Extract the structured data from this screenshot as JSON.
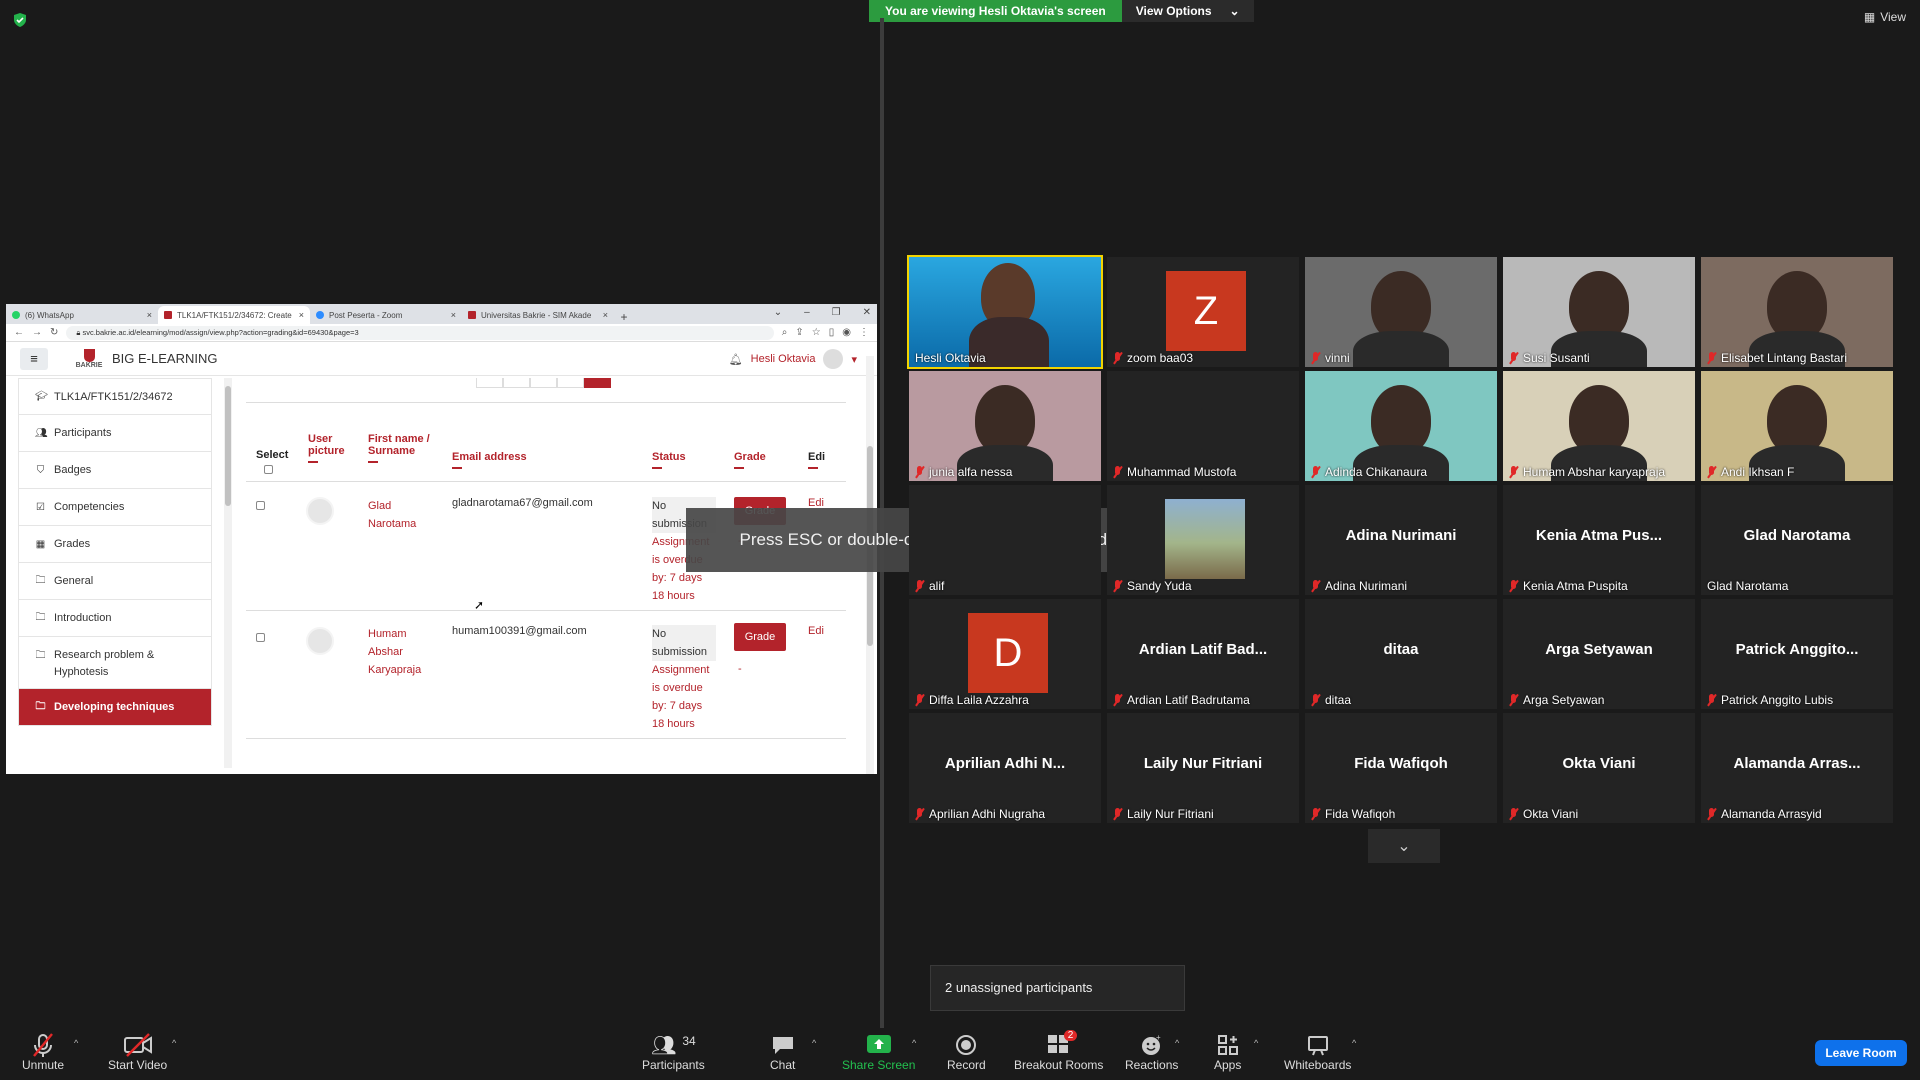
{
  "zoom": {
    "banner_text": "You are viewing Hesli Oktavia's screen",
    "view_options_label": "View Options",
    "view_label": "View",
    "esc_toast": "Press ESC or double-click to exit full screen mode",
    "unassigned_text": "2 unassigned participants",
    "participants_count": "34",
    "breakout_badge": "2",
    "leave_label": "Leave Room",
    "toolbar": {
      "unmute": "Unmute",
      "start_video": "Start Video",
      "participants": "Participants",
      "chat": "Chat",
      "share_screen": "Share Screen",
      "record": "Record",
      "breakout_rooms": "Breakout Rooms",
      "reactions": "Reactions",
      "apps": "Apps",
      "whiteboards": "Whiteboards"
    },
    "tiles": [
      {
        "name": "Hesli Oktavia",
        "big": "",
        "kind": "video-hesli",
        "muted": false
      },
      {
        "name": "zoom baa03",
        "big": "",
        "kind": "initial",
        "initial": "Z",
        "muted": true
      },
      {
        "name": "vinni",
        "big": "",
        "kind": "video",
        "muted": true
      },
      {
        "name": "Susi Susanti",
        "big": "",
        "kind": "video",
        "muted": true
      },
      {
        "name": "Elisabet Lintang Bastari",
        "big": "",
        "kind": "video",
        "muted": true
      },
      {
        "name": "junia alfa nessa",
        "big": "",
        "kind": "video",
        "muted": true
      },
      {
        "name": "Muhammad Mustofa",
        "big": "",
        "kind": "blank",
        "muted": true
      },
      {
        "name": "Adinda Chikanaura",
        "big": "",
        "kind": "video",
        "muted": true
      },
      {
        "name": "Humam Abshar karyapraja",
        "big": "",
        "kind": "video",
        "muted": true
      },
      {
        "name": "Andi Ikhsan F",
        "big": "",
        "kind": "video",
        "muted": true
      },
      {
        "name": "alif",
        "big": "",
        "kind": "blank",
        "muted": true
      },
      {
        "name": "Sandy Yuda",
        "big": "",
        "kind": "photo",
        "muted": true
      },
      {
        "name": "Adina Nurimani",
        "big": "Adina Nurimani",
        "kind": "name",
        "muted": true
      },
      {
        "name": "Kenia Atma Puspita",
        "big": "Kenia Atma Pus...",
        "kind": "name",
        "muted": true
      },
      {
        "name": "Glad Narotama",
        "big": "Glad Narotama",
        "kind": "name",
        "muted": false
      },
      {
        "name": "Diffa Laila Azzahra",
        "big": "",
        "kind": "initial",
        "initial": "D",
        "muted": true
      },
      {
        "name": "Ardian Latif Badrutama",
        "big": "Ardian Latif Bad...",
        "kind": "name",
        "muted": true
      },
      {
        "name": "ditaa",
        "big": "ditaa",
        "kind": "name",
        "muted": true
      },
      {
        "name": "Arga Setyawan",
        "big": "Arga Setyawan",
        "kind": "name",
        "muted": true
      },
      {
        "name": "Patrick Anggito Lubis",
        "big": "Patrick Anggito...",
        "kind": "name",
        "muted": true
      },
      {
        "name": "Aprilian Adhi Nugraha",
        "big": "Aprilian Adhi N...",
        "kind": "name",
        "muted": true
      },
      {
        "name": "Laily Nur Fitriani",
        "big": "Laily Nur Fitriani",
        "kind": "name",
        "muted": true
      },
      {
        "name": "Fida Wafiqoh",
        "big": "Fida Wafiqoh",
        "kind": "name",
        "muted": true
      },
      {
        "name": "Okta Viani",
        "big": "Okta Viani",
        "kind": "name",
        "muted": true
      },
      {
        "name": "Alamanda Arrasyid",
        "big": "Alamanda Arras...",
        "kind": "name",
        "muted": true
      }
    ]
  },
  "browser": {
    "tabs": [
      "(6) WhatsApp",
      "TLK1A/FTK151/2/34672: Create",
      "Post Peserta - Zoom",
      "Universitas Bakrie - SIM Akade"
    ],
    "url": "svc.bakrie.ac.id/elearning/mod/assign/view.php?action=grading&id=69430&page=3",
    "logo_text": "BAKRIE",
    "site_name": "BIG E-LEARNING",
    "user_name": "Hesli Oktavia",
    "drawer": [
      {
        "label": "TLK1A/FTK151/2/34672",
        "icon": "graduation-cap-icon"
      },
      {
        "label": "Participants",
        "icon": "users-icon"
      },
      {
        "label": "Badges",
        "icon": "shield-icon"
      },
      {
        "label": "Competencies",
        "icon": "check-square-icon"
      },
      {
        "label": "Grades",
        "icon": "table-icon"
      },
      {
        "label": "General",
        "icon": "folder-icon"
      },
      {
        "label": "Introduction",
        "icon": "folder-icon"
      },
      {
        "label": "Research problem & Hyphotesis",
        "icon": "folder-icon"
      },
      {
        "label": "Developing techniques",
        "icon": "folder-icon",
        "active": true
      }
    ],
    "table": {
      "headers": {
        "select": "Select",
        "user_picture": "User picture",
        "name": "First name / Surname",
        "email": "Email address",
        "status": "Status",
        "grade": "Grade",
        "edit": "Edi"
      },
      "rows": [
        {
          "name": "Glad Narotama",
          "email": "gladnarotama67@gmail.com",
          "status_ns": "No submission",
          "status_od": "Assignment is overdue by: 7 days 18 hours",
          "grade_btn": "Grade",
          "grade_dash": "-",
          "edit": "Edi"
        },
        {
          "name": "Humam Abshar Karyapraja",
          "email": "humam100391@gmail.com",
          "status_ns": "No submission",
          "status_od": "Assignment is overdue by: 7 days 18 hours",
          "grade_btn": "Grade",
          "grade_dash": "-",
          "edit": "Edi"
        }
      ]
    }
  }
}
